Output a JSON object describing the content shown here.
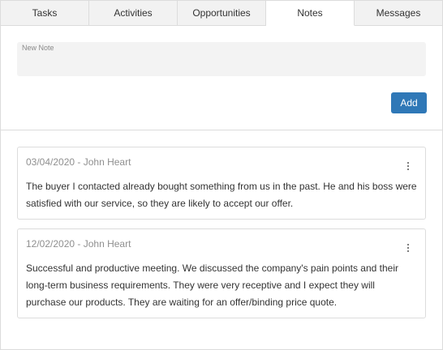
{
  "tabs": [
    {
      "label": "Tasks"
    },
    {
      "label": "Activities"
    },
    {
      "label": "Opportunities"
    },
    {
      "label": "Notes"
    },
    {
      "label": "Messages"
    }
  ],
  "active_tab": "Notes",
  "new_note": {
    "label": "New Note",
    "value": "",
    "add_label": "Add"
  },
  "notes": [
    {
      "date": "03/04/2020",
      "author": "John Heart",
      "meta": "03/04/2020 - John Heart",
      "text": "The buyer I contacted already bought something from us in the past. He and his boss were satisfied with our service, so they are likely to accept our offer."
    },
    {
      "date": "12/02/2020",
      "author": "John Heart",
      "meta": "12/02/2020 - John Heart",
      "text": "Successful and productive meeting. We discussed the company's pain points and their long-term business requirements. They were very receptive and I expect they will purchase our products. They are waiting for an offer/binding price quote."
    }
  ],
  "colors": {
    "accent": "#2f78b7",
    "border": "#dcdcdc",
    "tab_bg": "#f2f2f2",
    "meta_text": "#8f8f8f"
  },
  "icons": {
    "note_menu": "more-vertical-icon"
  }
}
